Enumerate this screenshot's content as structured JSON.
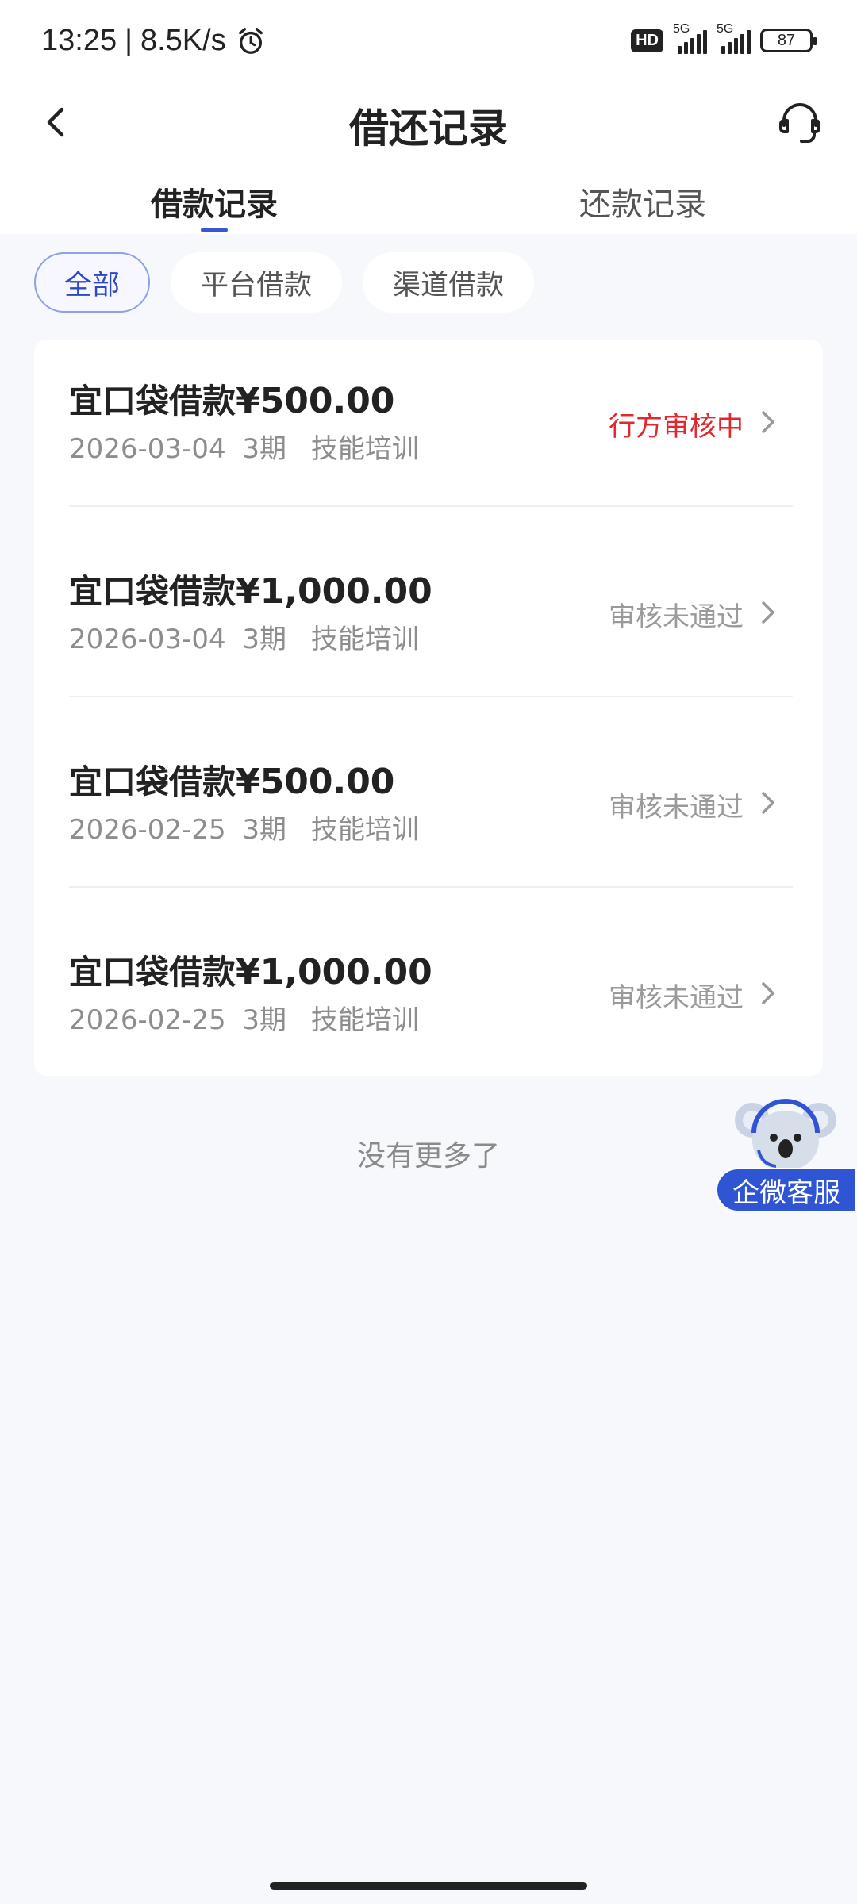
{
  "status_bar": {
    "time": "13:25",
    "net_speed": "8.5K/s",
    "hd_label": "HD",
    "network_1": "5G",
    "network_2": "5G",
    "battery": "87"
  },
  "header": {
    "title": "借还记录"
  },
  "tabs": [
    {
      "label": "借款记录",
      "active": true
    },
    {
      "label": "还款记录",
      "active": false
    }
  ],
  "filters": [
    {
      "label": "全部",
      "active": true
    },
    {
      "label": "平台借款",
      "active": false
    },
    {
      "label": "渠道借款",
      "active": false
    }
  ],
  "records": [
    {
      "title": "宜口袋借款",
      "amount": "¥500.00",
      "date": "2026-03-04",
      "periods": "3期",
      "purpose": "技能培训",
      "status": "行方审核中"
    },
    {
      "title": "宜口袋借款",
      "amount": "¥1,000.00",
      "date": "2026-03-04",
      "periods": "3期",
      "purpose": "技能培训",
      "status": "审核未通过"
    },
    {
      "title": "宜口袋借款",
      "amount": "¥500.00",
      "date": "2026-02-25",
      "periods": "3期",
      "purpose": "技能培训",
      "status": "审核未通过"
    },
    {
      "title": "宜口袋借款",
      "amount": "¥1,000.00",
      "date": "2026-02-25",
      "periods": "3期",
      "purpose": "技能培训",
      "status": "审核未通过"
    }
  ],
  "footer": {
    "no_more": "没有更多了"
  },
  "float_service": {
    "label": "企微客服"
  },
  "colors": {
    "accent": "#3a56d4",
    "pending": "#e0282e",
    "background": "#f7f8fc"
  }
}
